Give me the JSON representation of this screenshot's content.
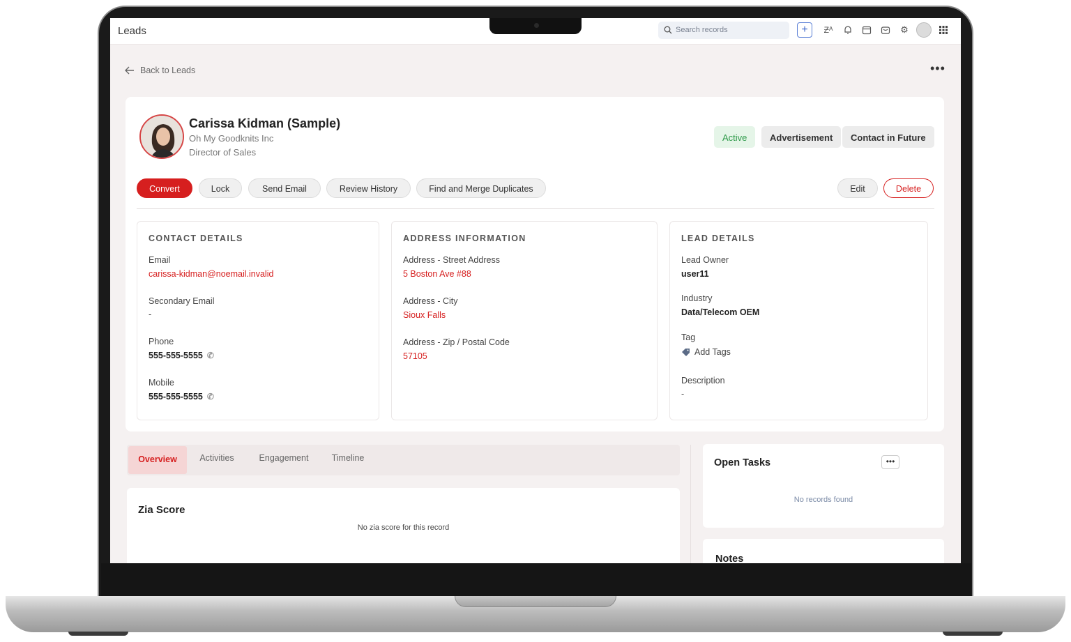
{
  "app": {
    "title": "Leads"
  },
  "topbar": {
    "search_placeholder": "Search records",
    "icons": [
      "search-icon",
      "plus-icon",
      "zia-icon",
      "bell-icon",
      "calendar-icon",
      "marketplace-icon",
      "gear-icon",
      "avatar",
      "apps-grid-icon"
    ]
  },
  "nav": {
    "back_label": "Back to Leads",
    "more_label": "•••"
  },
  "lead": {
    "name": "Carissa Kidman (Sample)",
    "company": "Oh My Goodknits Inc",
    "title": "Director of Sales",
    "tags": [
      "Active",
      "Advertisement",
      "Contact in Future"
    ]
  },
  "actions": {
    "convert": "Convert",
    "lock": "Lock",
    "send_email": "Send Email",
    "review_history": "Review History",
    "find_merge": "Find and Merge Duplicates",
    "edit": "Edit",
    "delete": "Delete"
  },
  "contact_details": {
    "title": "CONTACT DETAILS",
    "email_label": "Email",
    "email": "carissa-kidman@noemail.invalid",
    "secondary_email_label": "Secondary Email",
    "secondary_email": "-",
    "phone_label": "Phone",
    "phone": "555-555-5555",
    "mobile_label": "Mobile",
    "mobile": "555-555-5555"
  },
  "address_info": {
    "title": "ADDRESS INFORMATION",
    "street_label": "Address - Street Address",
    "street": "5 Boston Ave #88",
    "city_label": "Address - City",
    "city": "Sioux Falls",
    "zip_label": "Address - Zip / Postal Code",
    "zip": "57105"
  },
  "lead_details": {
    "title": "LEAD DETAILS",
    "owner_label": "Lead Owner",
    "owner": "user11",
    "industry_label": "Industry",
    "industry": "Data/Telecom OEM",
    "tag_label": "Tag",
    "add_tags": "Add Tags",
    "description_label": "Description",
    "description": "-"
  },
  "tabs": [
    "Overview",
    "Activities",
    "Engagement",
    "Timeline"
  ],
  "zia": {
    "title": "Zia Score",
    "empty": "No zia score for this record"
  },
  "open_tasks": {
    "title": "Open Tasks",
    "more": "•••",
    "empty": "No records found"
  },
  "notes": {
    "title": "Notes"
  },
  "colors": {
    "accent_red": "#d61f1f",
    "active_green": "#2f9a4a",
    "link_blue": "#3a64c8"
  }
}
